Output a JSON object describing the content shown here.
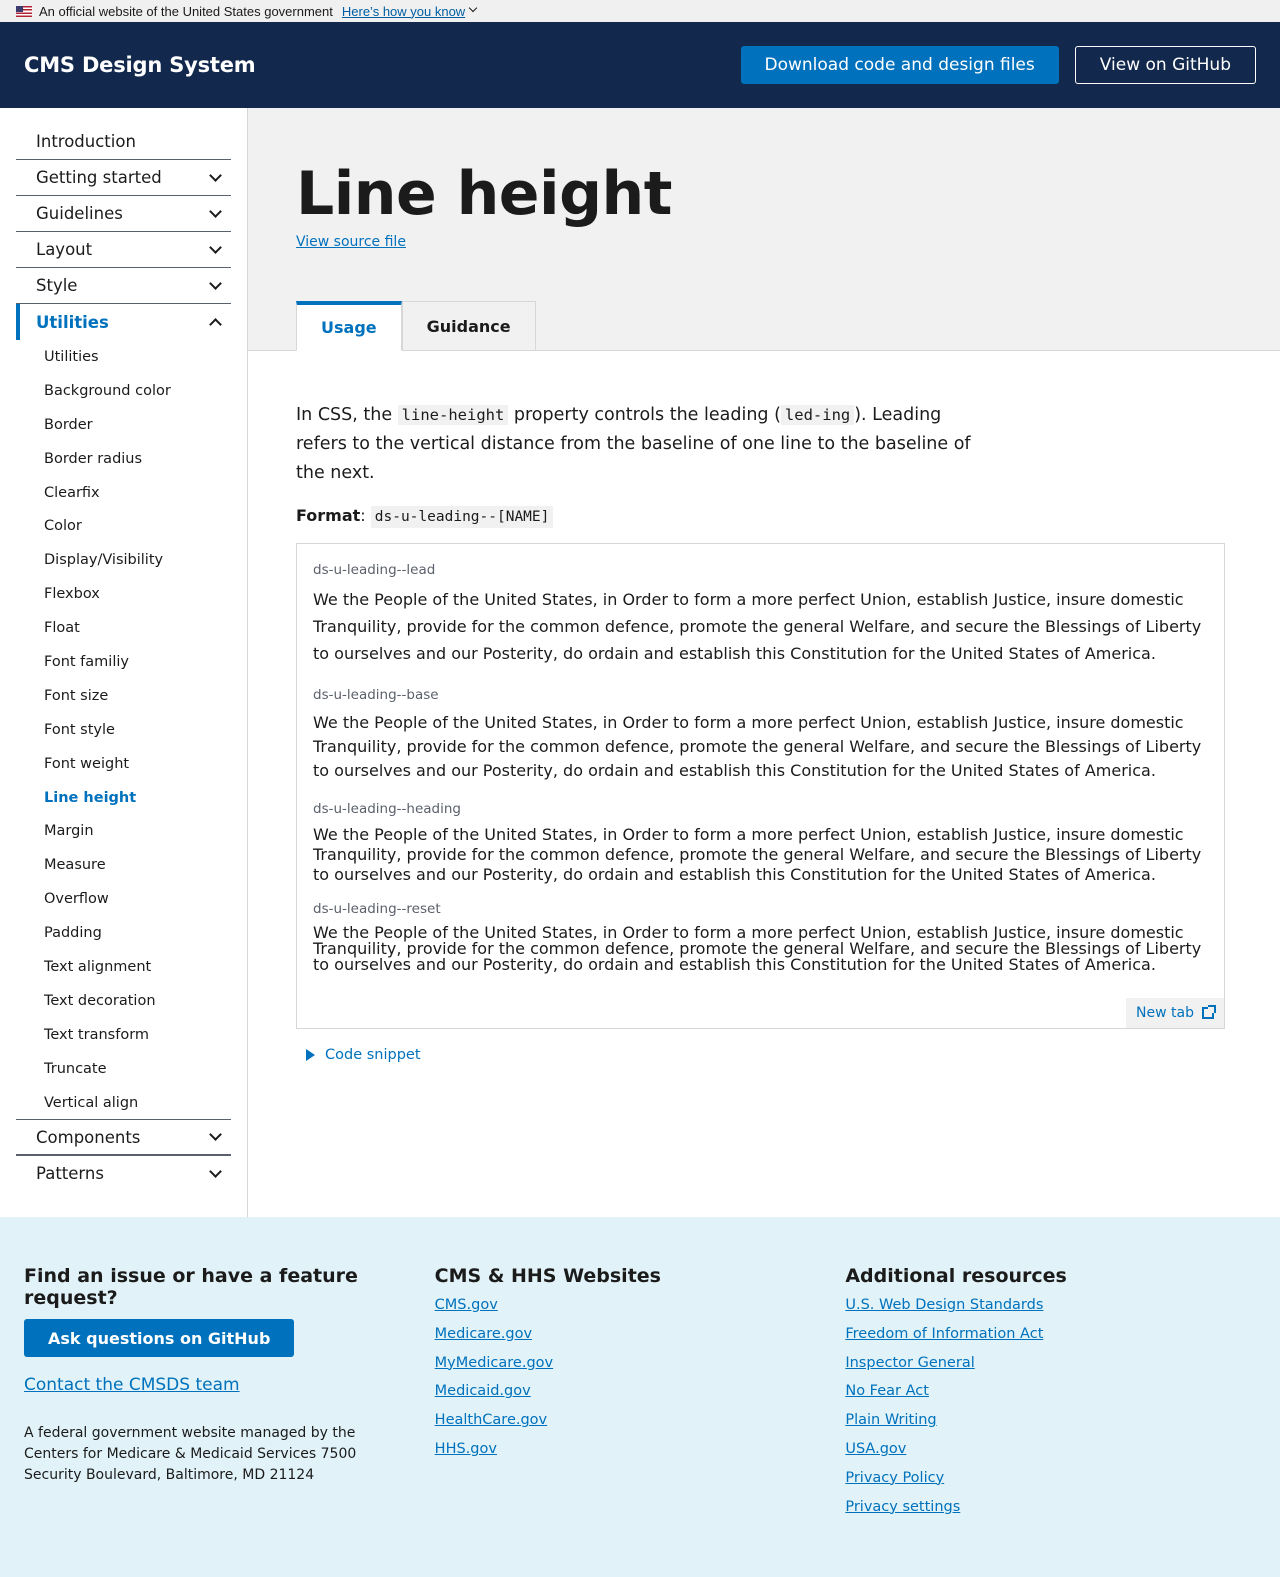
{
  "gov_banner": {
    "text": "An official website of the United States government",
    "link": "Here’s how you know"
  },
  "header": {
    "title": "CMS Design System",
    "download_label": "Download code and design files",
    "github_label": "View on GitHub"
  },
  "sidebar": {
    "top_items": [
      "Introduction",
      "Getting started",
      "Guidelines",
      "Layout",
      "Style"
    ],
    "active_section": "Utilities",
    "sub_items": [
      "Utilities",
      "Background color",
      "Border",
      "Border radius",
      "Clearfix",
      "Color",
      "Display/Visibility",
      "Flexbox",
      "Float",
      "Font familiy",
      "Font size",
      "Font style",
      "Font weight",
      "Line height",
      "Margin",
      "Measure",
      "Overflow",
      "Padding",
      "Text alignment",
      "Text decoration",
      "Text transform",
      "Truncate",
      "Vertical align"
    ],
    "current_sub_item": "Line height",
    "bottom_items": [
      "Components",
      "Patterns"
    ]
  },
  "page": {
    "title": "Line height",
    "source_link": "View source file",
    "tabs": [
      "Usage",
      "Guidance"
    ],
    "selected_tab": "Usage"
  },
  "content": {
    "intro_1": "In CSS, the ",
    "intro_code_1": "line-height",
    "intro_2": " property controls the leading (",
    "intro_code_2": "led-ing",
    "intro_3": "). Leading refers to the vertical distance from the baseline of one line to the baseline of the next.",
    "format_label": "Format",
    "format_code": "ds-u-leading--[NAME]",
    "examples": [
      {
        "label": "ds-u-leading--lead",
        "text": "We the People of the United States, in Order to form a more perfect Union, establish Justice, insure domestic Tranquility, provide for the common defence, promote the general Welfare, and secure the Blessings of Liberty to ourselves and our Posterity, do ordain and establish this Constitution for the United States of America."
      },
      {
        "label": "ds-u-leading--base",
        "text": "We the People of the United States, in Order to form a more perfect Union, establish Justice, insure domestic Tranquility, provide for the common defence, promote the general Welfare, and secure the Blessings of Liberty to ourselves and our Posterity, do ordain and establish this Constitution for the United States of America."
      },
      {
        "label": "ds-u-leading--heading",
        "text": "We the People of the United States, in Order to form a more perfect Union, establish Justice, insure domestic Tranquility, provide for the common defence, promote the general Welfare, and secure the Blessings of Liberty to ourselves and our Posterity, do ordain and establish this Constitution for the United States of America."
      },
      {
        "label": "ds-u-leading--reset",
        "text": "We the People of the United States, in Order to form a more perfect Union, establish Justice, insure domestic Tranquility, provide for the common defence, promote the general Welfare, and secure the Blessings of Liberty to ourselves and our Posterity, do ordain and establish this Constitution for the United States of America."
      }
    ],
    "new_tab": "New tab",
    "code_snippet": "Code snippet"
  },
  "footer": {
    "col1": {
      "heading": "Find an issue or have a feature request?",
      "button": "Ask questions on GitHub",
      "contact": "Contact the CMSDS team",
      "address": "A federal government website managed by the Centers for Medicare & Medicaid Services 7500 Security Boulevard, Baltimore, MD 21124"
    },
    "col2": {
      "heading": "CMS & HHS Websites",
      "links": [
        "CMS.gov",
        "Medicare.gov",
        "MyMedicare.gov",
        "Medicaid.gov",
        "HealthCare.gov",
        "HHS.gov"
      ]
    },
    "col3": {
      "heading": "Additional resources",
      "links": [
        "U.S. Web Design Standards",
        "Freedom of Information Act",
        "Inspector General",
        "No Fear Act",
        "Plain Writing",
        "USA.gov",
        "Privacy Policy",
        "Privacy settings"
      ]
    }
  },
  "colors": {
    "header_bg": "#12284c",
    "primary": "#0071bc",
    "footer_bg": "#e1f3f8",
    "hero_bg": "#f1f1f1"
  }
}
